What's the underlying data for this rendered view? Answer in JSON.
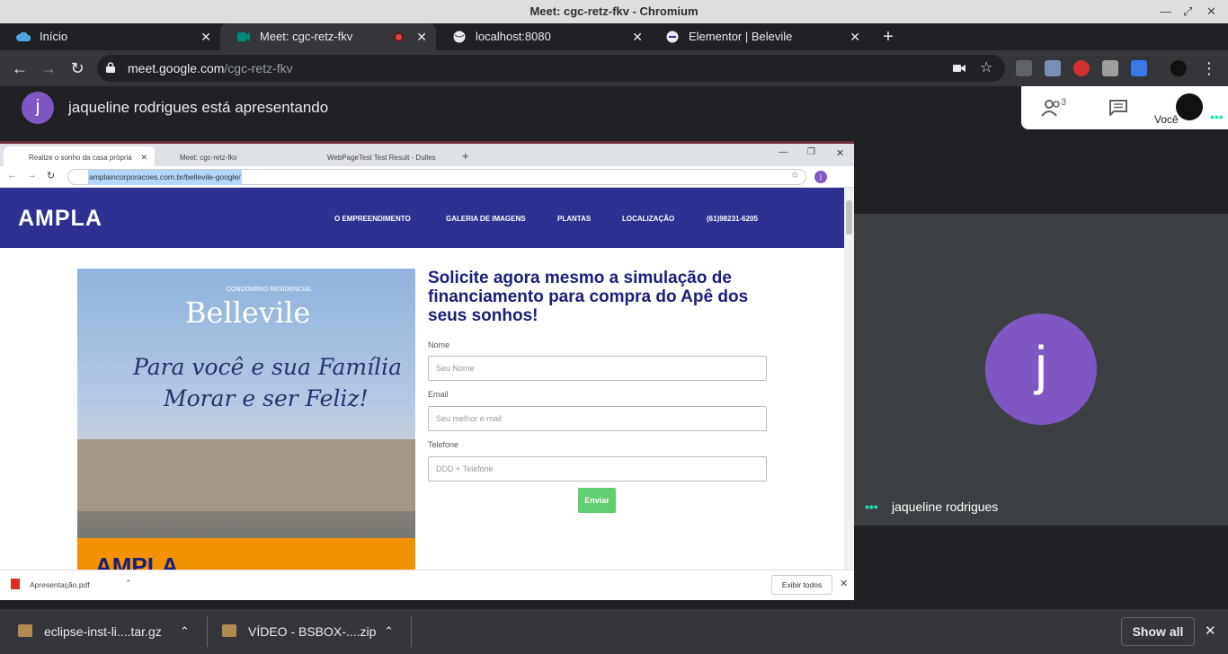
{
  "window": {
    "title": "Meet: cgc-retz-fkv - Chromium"
  },
  "tabs": [
    {
      "label": "Início",
      "icon": "cloud-icon"
    },
    {
      "label": "Meet: cgc-retz-fkv",
      "icon": "meet-icon"
    },
    {
      "label": "localhost:8080",
      "icon": "globe-icon"
    },
    {
      "label": "Elementor | Belevile",
      "icon": "ampla-icon"
    }
  ],
  "omnibox": {
    "host": "meet.google.com",
    "path": "/cgc-retz-fkv"
  },
  "meet": {
    "presenter_initial": "j",
    "presenting_text": "jaqueline rodrigues está apresentando",
    "participants_count": "3",
    "you_label": "Você",
    "tile_initial": "j",
    "tile_name": "jaqueline rodrigues"
  },
  "shared": {
    "tabs": [
      "Realize o sonho da casa própria",
      "Meet: cgc-retz-fkv",
      "WebPageTest Test Result - Dulles"
    ],
    "url": "amplaincorporacoes.com.br/bellevile-google/",
    "logo": "AMPLA",
    "nav": [
      "O EMPREENDIMENTO",
      "GALERIA DE IMAGENS",
      "PLANTAS",
      "LOCALIZAÇÃO",
      "(61)98231-6205"
    ],
    "hero": {
      "subtitle": "CONDOMÍNIO RESIDENCIAL",
      "brand": "Bellevile",
      "tagline_1": "Para você e sua Família",
      "tagline_2": "Morar e ser Feliz!",
      "footer_logo": "AMPLA"
    },
    "form": {
      "title": "Solicite agora mesmo a simulação de financiamento para compra do Apê dos seus sonhos!",
      "name_label": "Nome",
      "name_placeholder": "Seu Nome",
      "email_label": "Email",
      "email_placeholder": "Seu melhor e-mail",
      "phone_label": "Telefone",
      "phone_placeholder": "DDD + Telefone",
      "submit": "Enviar"
    },
    "download": {
      "file": "Apresentação.pdf",
      "show_all": "Exibir todos"
    }
  },
  "downloads": [
    {
      "file": "eclipse-inst-li....tar.gz"
    },
    {
      "file": "VÍDEO - BSBOX-....zip"
    }
  ],
  "show_all": "Show all",
  "colors": {
    "meet_bg": "#202124",
    "tile_bg": "#3c4043",
    "avatar": "#7e57c2",
    "ampla_blue": "#2e3192",
    "enviar_green": "#61ce70"
  }
}
